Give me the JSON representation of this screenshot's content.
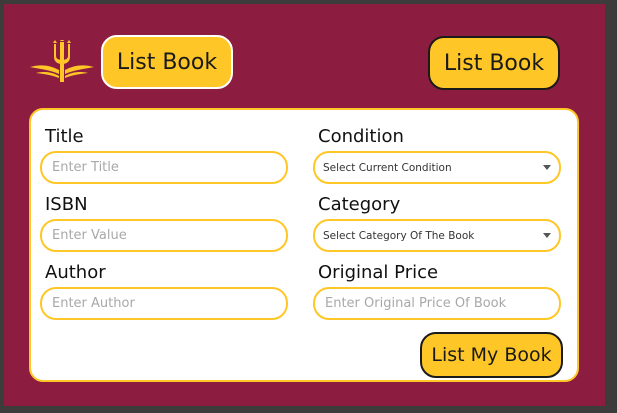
{
  "header": {
    "logo_icon": "pitchfork-logo-icon",
    "left_button_label": "List Book",
    "right_button_label": "List Book"
  },
  "form": {
    "title": {
      "label": "Title",
      "placeholder": "Enter Title"
    },
    "condition": {
      "label": "Condition",
      "selected": "Select Current Condition"
    },
    "isbn": {
      "label": "ISBN",
      "placeholder": "Enter Value"
    },
    "category": {
      "label": "Category",
      "selected": "Select Category Of The Book"
    },
    "author": {
      "label": "Author",
      "placeholder": "Enter Author"
    },
    "original_price": {
      "label": "Original Price",
      "placeholder": "Enter Original Price Of Book"
    },
    "submit_label": "List My Book"
  },
  "colors": {
    "background": "#8c1d40",
    "accent": "#ffc627",
    "card": "#ffffff"
  }
}
